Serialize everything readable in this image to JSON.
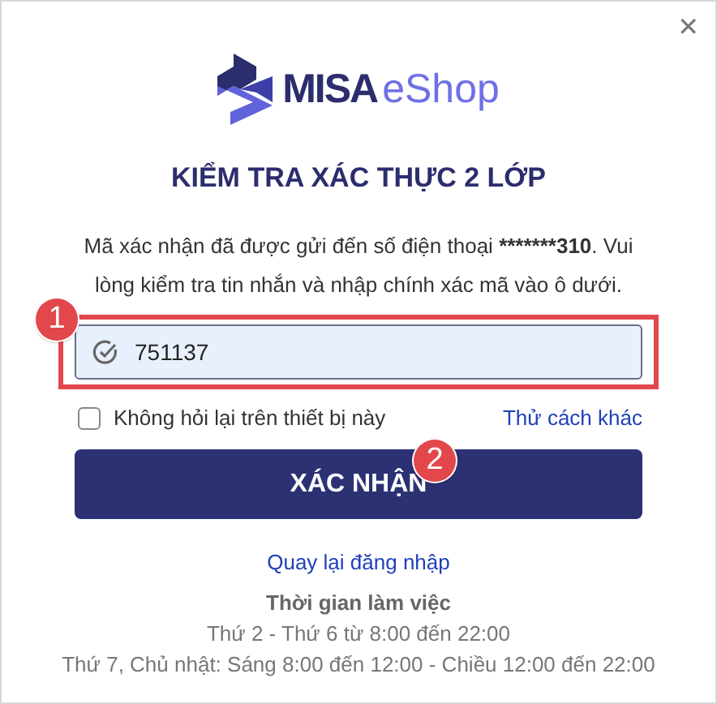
{
  "close_button": {
    "label": "✕"
  },
  "logo": {
    "brand": "MISA",
    "product": "eShop"
  },
  "title": "KIỂM TRA XÁC THỰC 2 LỚP",
  "description": {
    "before": "Mã xác nhận đã được gửi đến số điện thoại ",
    "phone": "*******310",
    "after": ". Vui lòng kiểm tra tin nhắn và nhập chính xác mã vào ô dưới."
  },
  "code_field": {
    "value": "751137",
    "step_badge": "1"
  },
  "remember_device": {
    "label": "Không hỏi lại trên thiết bị này",
    "checked": false
  },
  "other_method_link": "Thử cách khác",
  "confirm_button": {
    "label": "XÁC NHẬN",
    "step_badge": "2"
  },
  "back_link": "Quay lại đăng nhập",
  "working_hours": {
    "title": "Thời gian làm việc",
    "lines": [
      "Thứ 2 - Thứ 6 từ 8:00 đến 22:00",
      "Thứ 7, Chủ nhật: Sáng 8:00 đến 12:00 - Chiều 12:00 đến 22:00"
    ]
  }
}
